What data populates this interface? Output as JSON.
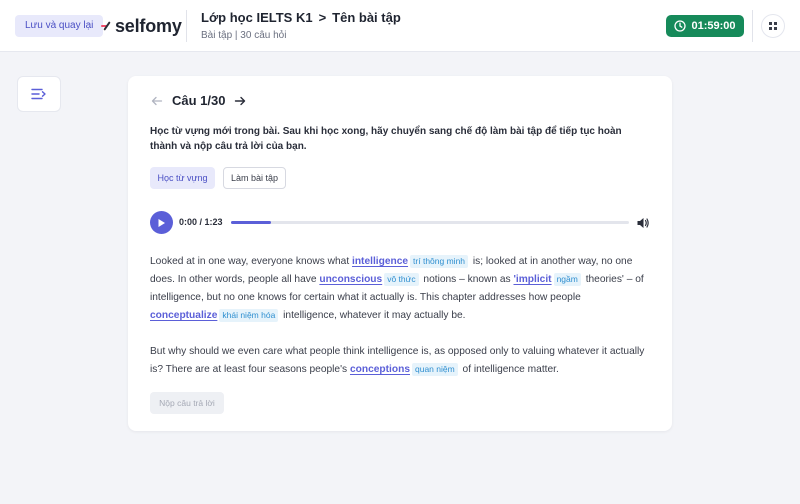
{
  "header": {
    "back_label": "Lưu và quay lại",
    "logo_text": "selfomy",
    "class_name": "Lớp học IELTS K1",
    "separator": ">",
    "assignment_name": "Tên bài tập",
    "assignment_info": "Bài tập | 30 câu hỏi",
    "timer": "01:59:00"
  },
  "question": {
    "label": "Câu 1/30",
    "instruction": "Học từ vựng mới trong bài. Sau khi học xong, hãy chuyển sang chế độ làm bài tập để tiếp tục hoàn thành và nộp câu trả lời của bạn."
  },
  "modes": {
    "learn": "Học từ vựng",
    "practice": "Làm bài tập"
  },
  "audio": {
    "time": "0:00 / 1:23",
    "progress": 0.1
  },
  "passage": {
    "p1": {
      "t1": "Looked at in one way, everyone knows what",
      "v1": "intelligence",
      "tr1": "trí thông minh",
      "t2": "is; looked at in another way, no one does. In other words, people all have",
      "v2": "unconscious",
      "tr2": "vô thức",
      "t3": "notions – known as",
      "v3": "'implicit",
      "tr3": "ngầm",
      "t4": "theories' – of intelligence, but no one knows for certain what it actually is. This chapter addresses how people",
      "v4": "conceptualize",
      "tr4": "khái niệm hóa",
      "t5": "intelligence, whatever it may actually be."
    },
    "p2": {
      "t1": "But why should we even care what people think intelligence is, as opposed only to valuing whatever it actually is? There are at least four seasons people's",
      "v1": "conceptions",
      "tr1": "quan niệm",
      "t2": "of intelligence matter."
    }
  },
  "submit_label": "Nộp câu trả lời",
  "colors": {
    "accent": "#5b5fd8",
    "timer_bg": "#168a5a",
    "translation_bg": "#e6f3fb",
    "translation_text": "#2f8fd0"
  }
}
